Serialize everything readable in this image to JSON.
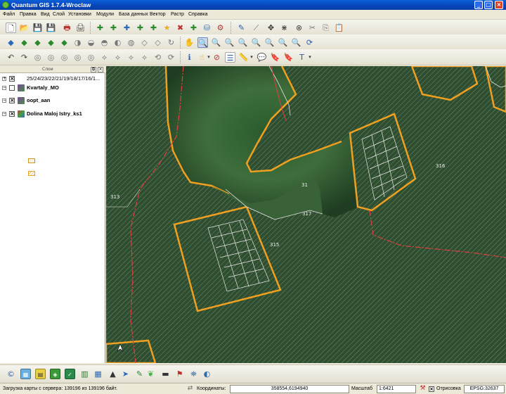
{
  "window": {
    "title": "Quantum GIS 1.7.4-Wroclaw",
    "minimize": "_",
    "maximize": "□",
    "close": "×"
  },
  "menu": [
    "Файл",
    "Правка",
    "Вид",
    "Слой",
    "Установки",
    "Модули",
    "База данных",
    "Вектор",
    "Растр",
    "Справка"
  ],
  "layers_panel": {
    "title": "Слои",
    "float_btn": "⧉",
    "close_btn": "×",
    "layers": [
      {
        "name": "25/24/23/22/21/19/18/17/16/1...",
        "checked": "×",
        "expand": "+"
      },
      {
        "name": "Kvartaly_MO",
        "checked": "",
        "expand": "−"
      },
      {
        "name": "oopt_aan",
        "checked": "×",
        "expand": "−"
      },
      {
        "name": "Dolina Maloj Istry_ks1",
        "checked": "×",
        "expand": "−"
      }
    ]
  },
  "map": {
    "labels": [
      "313",
      "315",
      "316",
      "317",
      "31"
    ],
    "colors": {
      "hatch_fill": "#3d5a3a",
      "border_orange": "#f0a020",
      "border_red": "#e04040",
      "lines_white": "#e8e8e8"
    }
  },
  "status": {
    "loading_text": "Загрузка карты с сервера: 139196 из 139196 байт.",
    "coords_label": "Координаты:",
    "coords_value": "358554,6194940",
    "scale_label": "Масштаб",
    "scale_value": "1:6421",
    "render_label": "Отрисовка",
    "render_checked": "×",
    "crs": "EPSG:32637"
  }
}
